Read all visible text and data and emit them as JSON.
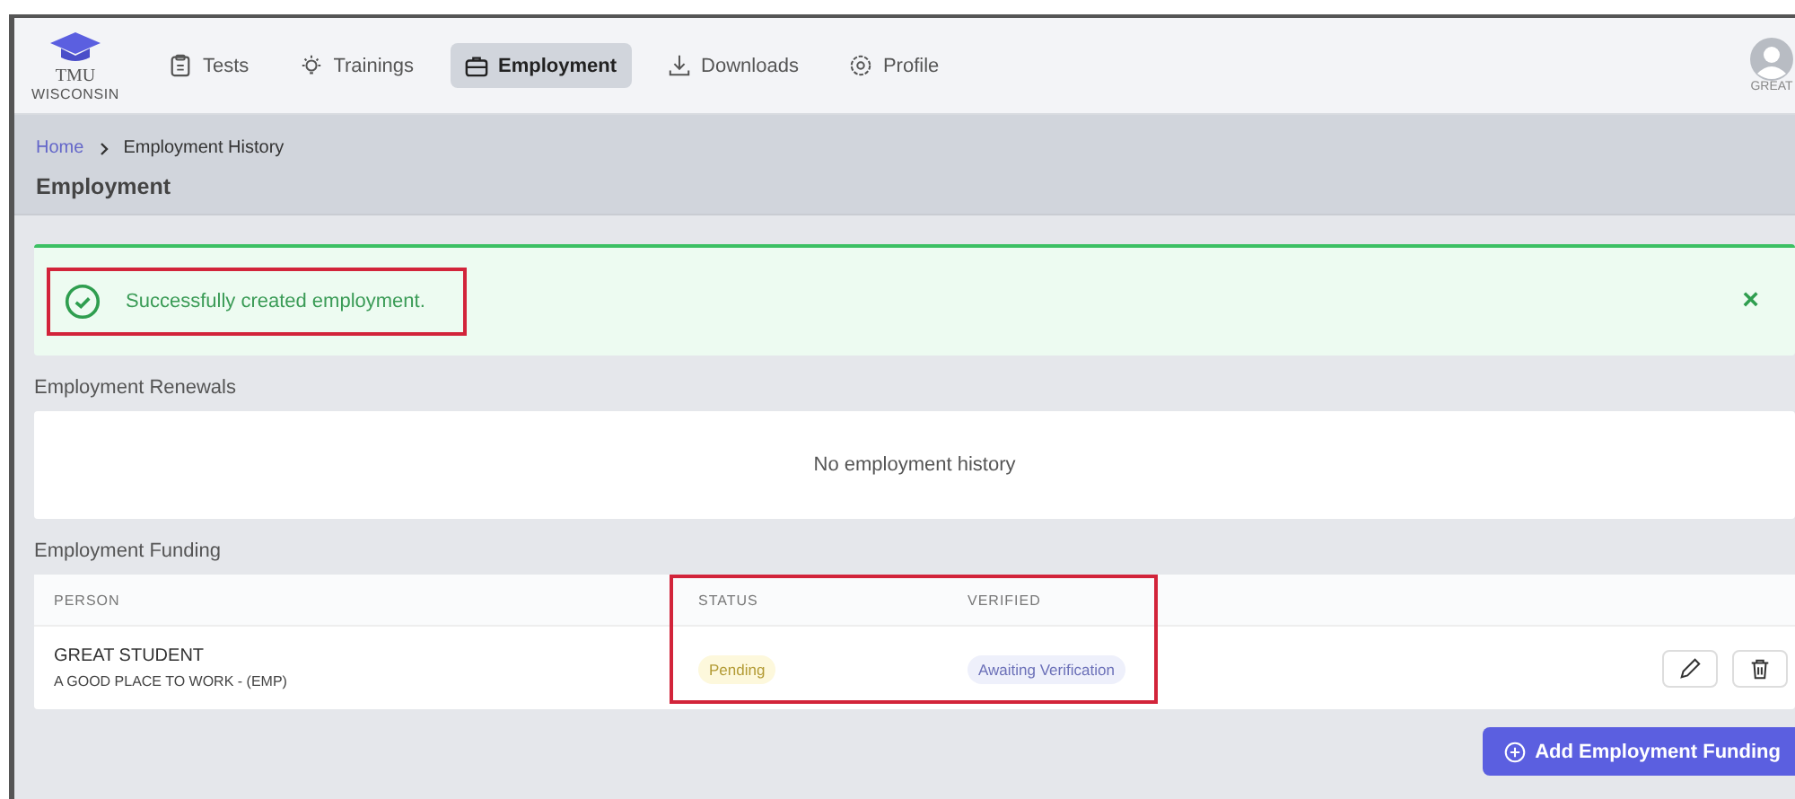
{
  "logo": {
    "line1": "TMU",
    "line2": "WISCONSIN"
  },
  "nav": [
    {
      "label": "Tests",
      "kind": "clipboard",
      "selected": false
    },
    {
      "label": "Trainings",
      "kind": "bulb",
      "selected": false
    },
    {
      "label": "Employment",
      "kind": "briefcase",
      "selected": true
    },
    {
      "label": "Downloads",
      "kind": "download",
      "selected": false
    },
    {
      "label": "Profile",
      "kind": "gear",
      "selected": false
    }
  ],
  "user": {
    "name": "GREAT"
  },
  "breadcrumb": [
    "Home",
    "Employment History"
  ],
  "page_title": "Employment",
  "alert": {
    "message": "Successfully created employment.",
    "close": "×"
  },
  "renewals": {
    "title": "Employment Renewals",
    "empty": "No employment history"
  },
  "funding": {
    "title": "Employment Funding",
    "columns": [
      "PERSON",
      "STATUS",
      "VERIFIED"
    ],
    "rows": [
      {
        "person": "GREAT STUDENT",
        "employer": "A GOOD PLACE TO WORK - (EMP)",
        "status": "Pending",
        "verified": "Awaiting Verification"
      }
    ]
  },
  "add_button": "Add Employment Funding"
}
